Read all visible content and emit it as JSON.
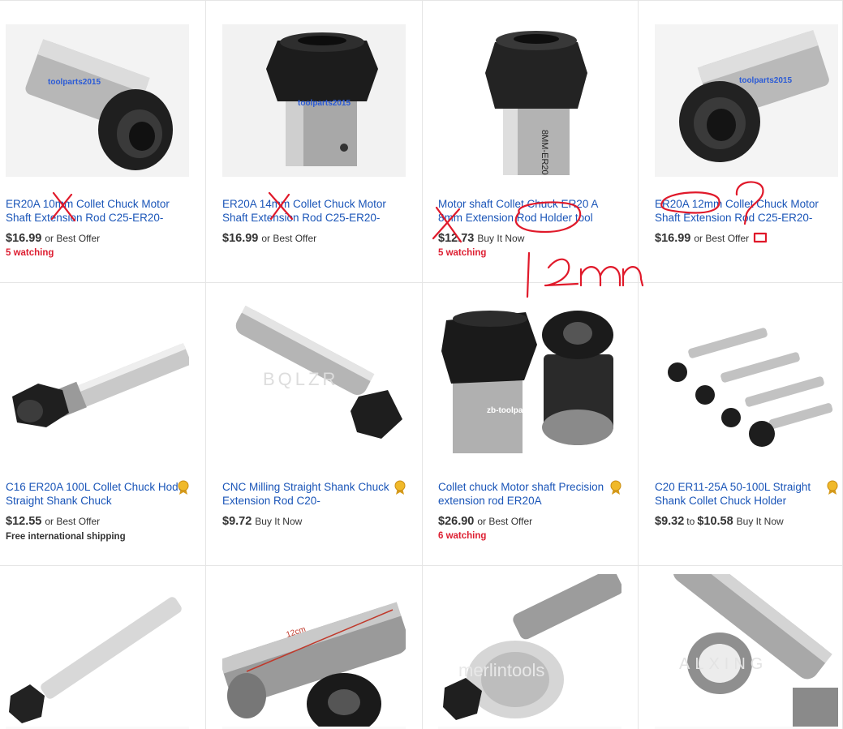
{
  "rows": [
    {
      "items": [
        {
          "title": "ER20A 10mm Collet Chuck Motor Shaft Extension Rod C25-ER20-",
          "price": "$16.99",
          "format": "or Best Offer",
          "watch": "5 watching",
          "watermark": "toolparts2015"
        },
        {
          "title": "ER20A 14mm Collet Chuck Motor Shaft Extension Rod C25-ER20-",
          "price": "$16.99",
          "format": "or Best Offer",
          "watermark": "toolparts2015"
        },
        {
          "title": "Motor shaft Collet Chuck ER20 A 8mm Extension Rod Holder tool",
          "price": "$12.73",
          "format": "Buy It Now",
          "watch": "5 watching",
          "engraving": "8MM-ER20"
        },
        {
          "title": "ER20A 12mm Collet Chuck Motor Shaft Extension Rod C25-ER20-",
          "price": "$16.99",
          "format": "or Best Offer",
          "watermark": "toolparts2015"
        }
      ]
    },
    {
      "items": [
        {
          "title": "C16 ER20A 100L Collet Chuck Hoder Straight Shank Chuck",
          "price": "$12.55",
          "format": "or Best Offer",
          "shipping": "Free international shipping",
          "badge": "award-icon"
        },
        {
          "title": "CNC Milling Straight Shank Chuck Extension Rod C20-",
          "price": "$9.72",
          "format": "Buy It Now",
          "watermark": "BQLZR",
          "badge": "award-icon"
        },
        {
          "title": "Collet chuck Motor shaft Precision extension rod ER20A",
          "price": "$26.90",
          "format": "or Best Offer",
          "watch": "6 watching",
          "watermark": "zb-toolparts",
          "badge": "award-icon"
        },
        {
          "title": "C20 ER11-25A 50-100L Straight Shank Collet Chuck Holder",
          "price": "$9.32",
          "to": "to",
          "price2": "$10.58",
          "format": "Buy It Now",
          "badge": "award-icon"
        }
      ]
    },
    {
      "items": [
        {
          "watermark": ""
        },
        {
          "dimension": "12cm"
        },
        {
          "watermark": "merlintools"
        },
        {
          "watermark": "ALXING"
        }
      ]
    }
  ],
  "annotation": {
    "handwritten_note": "12mm",
    "marks": [
      "x-mark",
      "x-mark",
      "x-mark",
      "circle",
      "question-mark",
      "circle"
    ],
    "color": "#e0192a"
  },
  "colors": {
    "link": "#1a55b8",
    "watching": "#dd1e31",
    "annotation": "#e0192a",
    "divider": "#e5e5e5"
  }
}
